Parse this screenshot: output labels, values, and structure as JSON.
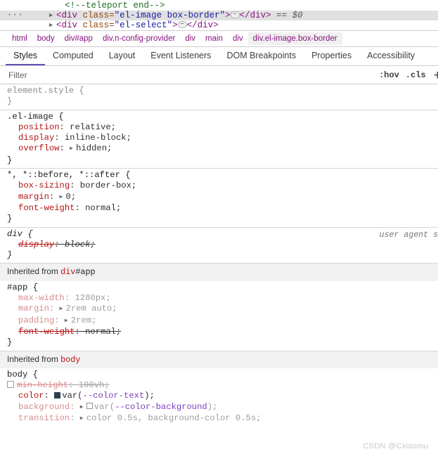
{
  "dom_tree": {
    "rows": [
      {
        "type": "comment",
        "indent": 92,
        "text": "<!--teleport end-->",
        "selected": false,
        "has_twisty": false,
        "gutter": ""
      },
      {
        "type": "element",
        "indent": 70,
        "selected": true,
        "has_twisty": true,
        "gutter": "···",
        "open_lt": "<",
        "tag": "div",
        "attr_name": "class",
        "attr_eq": "=",
        "attr_value": "\"el-image box-border\"",
        "open_gt": ">",
        "collapsed_badge": "⋯",
        "close": "</div>",
        "ref": "== $0"
      },
      {
        "type": "element",
        "indent": 70,
        "selected": false,
        "has_twisty": true,
        "gutter": "",
        "open_lt": "<",
        "tag": "div",
        "attr_name": "class",
        "attr_eq": "=",
        "attr_value": "\"el-select\"",
        "open_gt": ">",
        "collapsed_badge": "⋯",
        "close": "</div>",
        "ref": ""
      }
    ]
  },
  "breadcrumb": {
    "items": [
      {
        "label": "html",
        "active": false
      },
      {
        "label": "body",
        "active": false
      },
      {
        "label": "div#app",
        "active": false
      },
      {
        "label": "div.n-config-provider",
        "active": false
      },
      {
        "label": "div",
        "active": false
      },
      {
        "label": "main",
        "active": false
      },
      {
        "label": "div",
        "active": false
      },
      {
        "label": "div.el-image.box-border",
        "active": true
      }
    ]
  },
  "tabs": {
    "items": [
      {
        "label": "Styles",
        "active": true
      },
      {
        "label": "Computed",
        "active": false
      },
      {
        "label": "Layout",
        "active": false
      },
      {
        "label": "Event Listeners",
        "active": false
      },
      {
        "label": "DOM Breakpoints",
        "active": false
      },
      {
        "label": "Properties",
        "active": false
      },
      {
        "label": "Accessibility",
        "active": false
      }
    ],
    "active_underline_color": "#6051b5"
  },
  "filter": {
    "placeholder": "Filter",
    "value": "",
    "hov_label": ":hov",
    "cls_label": ".cls",
    "plus_label": "+"
  },
  "styles": {
    "rules": [
      {
        "id": "element-style",
        "selector": "element.style {",
        "selector_style": "grey",
        "close": "}",
        "source": "",
        "declarations": []
      },
      {
        "id": "el-image",
        "selector": ".el-image {",
        "selector_style": "dark",
        "close": "}",
        "source": "",
        "declarations": [
          {
            "prop": "position",
            "colon": ":",
            "value": "relative;",
            "dim": false,
            "strike": false,
            "expander": false,
            "checkbox": false
          },
          {
            "prop": "display",
            "colon": ":",
            "value": "inline-block;",
            "dim": false,
            "strike": false,
            "expander": false,
            "checkbox": false
          },
          {
            "prop": "overflow",
            "colon": ":",
            "value": "hidden;",
            "dim": false,
            "strike": false,
            "expander": true,
            "checkbox": false
          }
        ]
      },
      {
        "id": "universal",
        "selector": "*, *::before, *::after {",
        "selector_style": "dark",
        "close": "}",
        "source": "",
        "declarations": [
          {
            "prop": "box-sizing",
            "colon": ":",
            "value": "border-box;",
            "dim": false,
            "strike": false,
            "expander": false,
            "checkbox": false
          },
          {
            "prop": "margin",
            "colon": ":",
            "value": "0;",
            "dim": false,
            "strike": false,
            "expander": true,
            "checkbox": false
          },
          {
            "prop": "font-weight",
            "colon": ":",
            "value": "normal;",
            "dim": false,
            "strike": false,
            "expander": false,
            "checkbox": false
          }
        ]
      },
      {
        "id": "div-ua",
        "selector": "div {",
        "selector_style": "italic",
        "close": "}",
        "source": "user agent s",
        "declarations": [
          {
            "prop": "display",
            "colon": ":",
            "value": "block;",
            "dim": false,
            "strike": true,
            "expander": false,
            "checkbox": false,
            "italic": true
          }
        ]
      }
    ],
    "inherited_sections": [
      {
        "header_prefix": "Inherited from ",
        "header_tag": "div",
        "header_id": "#app",
        "rules": [
          {
            "id": "app",
            "selector": "#app {",
            "selector_style": "dark",
            "close": "}",
            "source": "",
            "declarations": [
              {
                "prop": "max-width",
                "colon": ":",
                "value": "1280px;",
                "dim": true,
                "strike": false,
                "expander": false,
                "checkbox": false
              },
              {
                "prop": "margin",
                "colon": ":",
                "value": "2rem auto;",
                "dim": true,
                "strike": false,
                "expander": true,
                "checkbox": false
              },
              {
                "prop": "padding",
                "colon": ":",
                "value": "2rem;",
                "dim": true,
                "strike": false,
                "expander": true,
                "checkbox": false
              },
              {
                "prop": "font-weight",
                "colon": ":",
                "value": "normal;",
                "dim": false,
                "strike": true,
                "expander": false,
                "checkbox": false
              }
            ]
          }
        ]
      },
      {
        "header_prefix": "Inherited from ",
        "header_tag": "body",
        "header_id": "",
        "rules": [
          {
            "id": "body",
            "selector": "body {",
            "selector_style": "dark",
            "close": "",
            "source": "",
            "declarations": [
              {
                "prop": "min-height",
                "colon": ":",
                "value": "100vh;",
                "dim": true,
                "strike": true,
                "expander": false,
                "checkbox": true
              },
              {
                "prop": "color",
                "colon": ":",
                "value": "var(--color-text);",
                "dim": false,
                "strike": false,
                "expander": false,
                "checkbox": false,
                "swatch": "dark",
                "var": "--color-text"
              },
              {
                "prop": "background",
                "colon": ":",
                "value": "var(--color-background);",
                "dim": true,
                "strike": false,
                "expander": true,
                "checkbox": false,
                "swatch": "light",
                "var": "--color-background"
              },
              {
                "prop": "transition",
                "colon": ":",
                "value": "color 0.5s, background-color 0.5s;",
                "dim": true,
                "strike": false,
                "expander": true,
                "checkbox": false
              }
            ]
          }
        ]
      }
    ]
  },
  "watermark": "CSDN @Cxiaomu"
}
